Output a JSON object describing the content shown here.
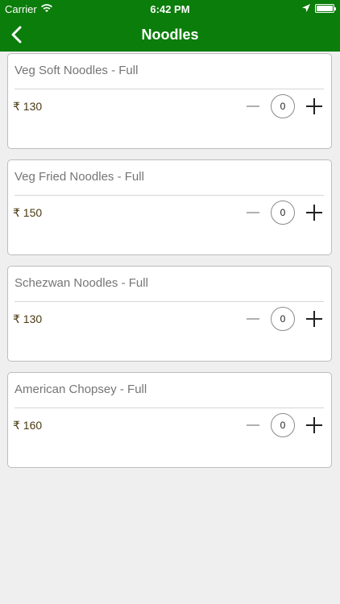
{
  "status_bar": {
    "carrier": "Carrier",
    "time": "6:42 PM"
  },
  "nav": {
    "title": "Noodles",
    "back_icon": "chevron-left-icon"
  },
  "colors": {
    "nav_bg": "#0b7d0b",
    "page_bg": "#efefef",
    "price_text": "#4a3a12"
  },
  "items": [
    {
      "name": "Veg Soft Noodles - Full",
      "price": "₹ 130",
      "quantity": "0"
    },
    {
      "name": "Veg Fried Noodles - Full",
      "price": "₹ 150",
      "quantity": "0"
    },
    {
      "name": "Schezwan Noodles - Full",
      "price": "₹ 130",
      "quantity": "0"
    },
    {
      "name": "American Chopsey - Full",
      "price": "₹ 160",
      "quantity": "0"
    }
  ]
}
